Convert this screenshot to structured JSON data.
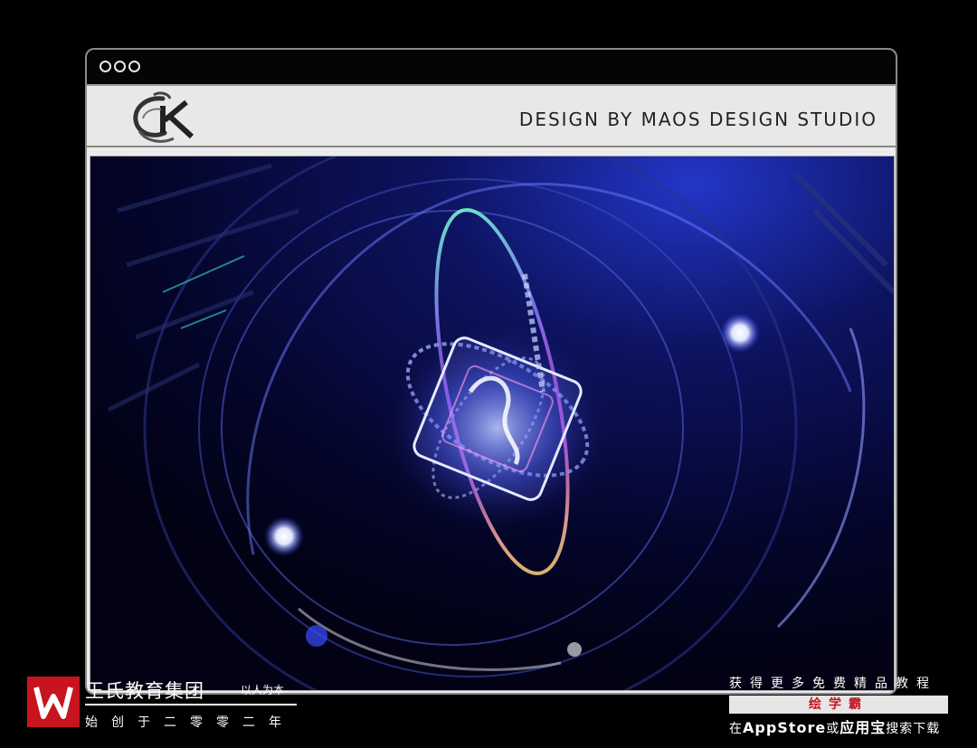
{
  "window": {
    "header_text": "DESIGN BY MAOS DESIGN STUDIO"
  },
  "colors": {
    "background": "#000000",
    "frame": "#ececec",
    "scene": "#040420",
    "accent_blue": "#3a4dff",
    "brand_red": "#c8141e"
  },
  "watermark_left": {
    "title": "王氏教育集团",
    "slogan": "以人为本",
    "since": "始创于二零零二年"
  },
  "watermark_right": {
    "line1": "获得更多免费精品教程",
    "line2": "绘学霸",
    "line3_prefix": "在",
    "line3_app1": "AppStore",
    "line3_mid": "或",
    "line3_app2": "应用宝",
    "line3_suffix": "搜索下载"
  }
}
